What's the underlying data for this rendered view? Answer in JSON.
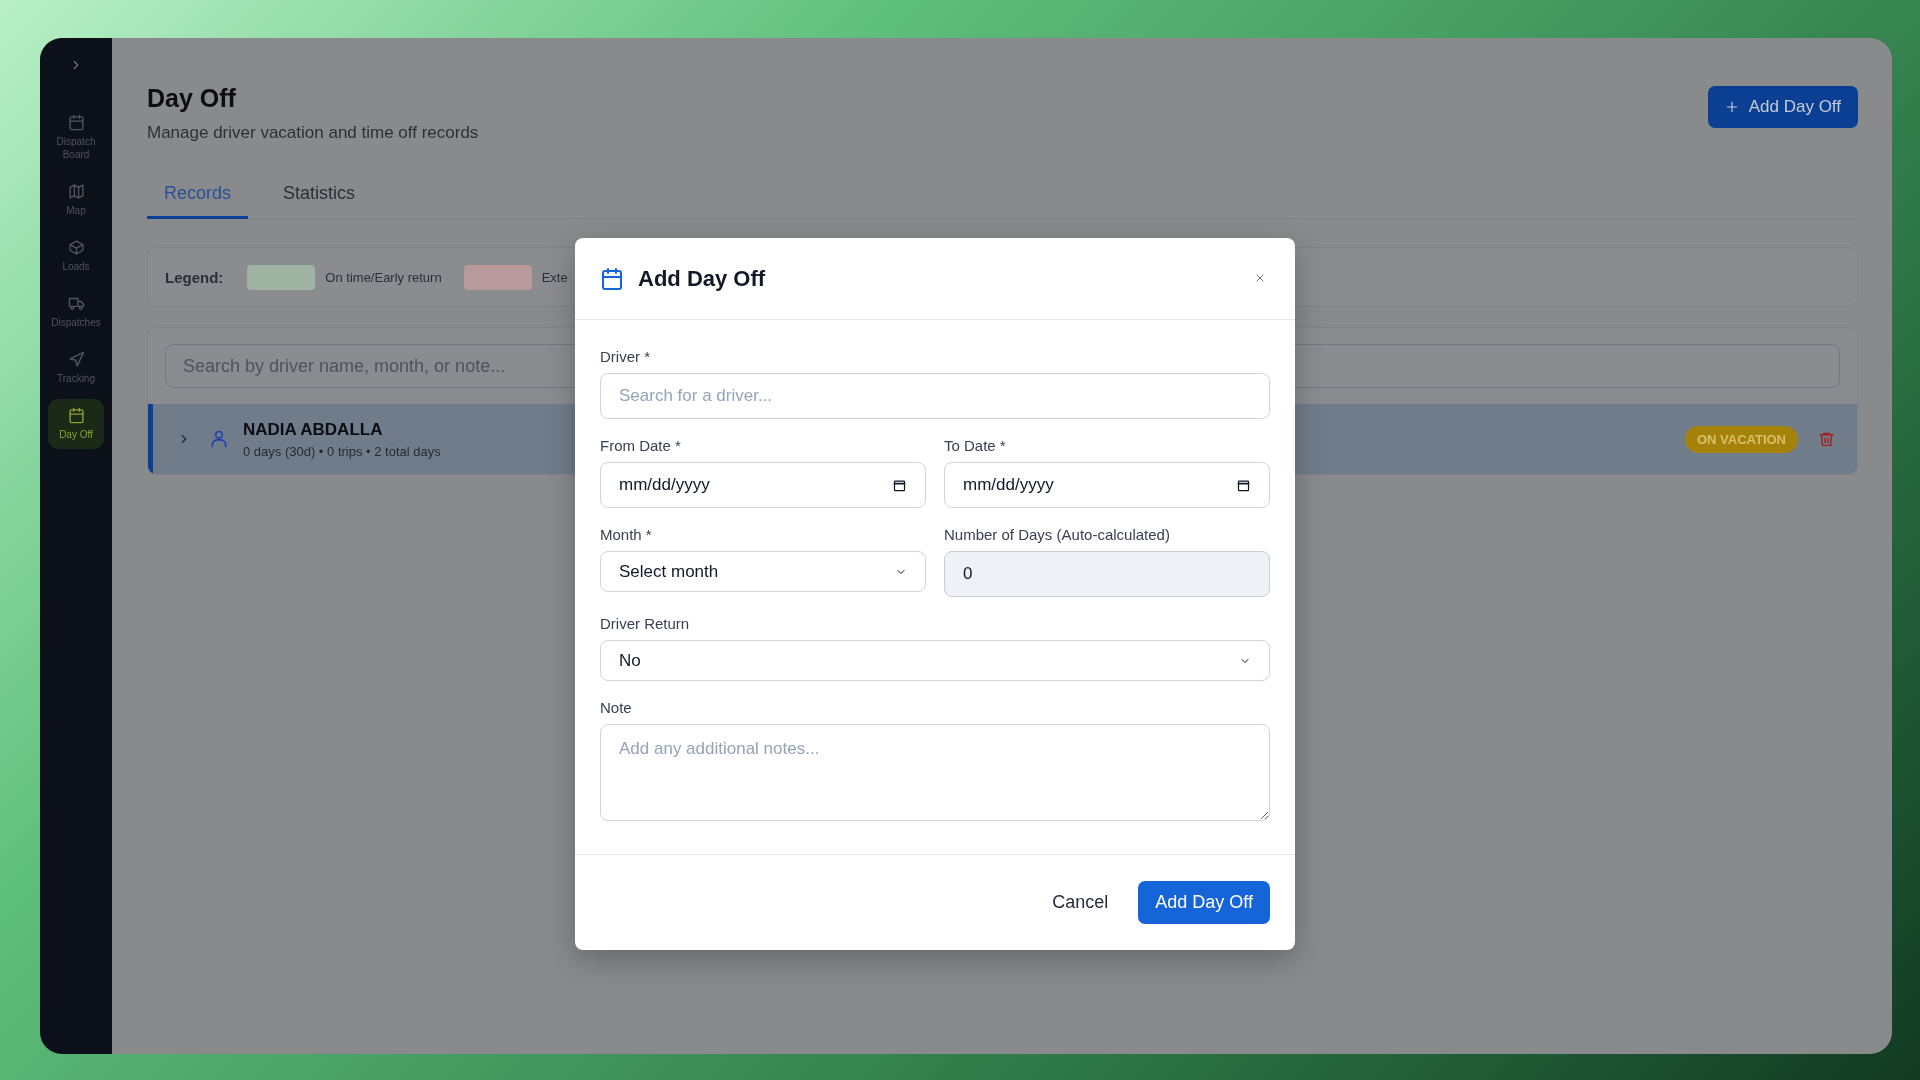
{
  "sidebar": {
    "items": [
      {
        "label": "Dispatch Board",
        "selected": false
      },
      {
        "label": "Map",
        "selected": false
      },
      {
        "label": "Loads",
        "selected": false
      },
      {
        "label": "Dispatches",
        "selected": false
      },
      {
        "label": "Tracking",
        "selected": false
      },
      {
        "label": "Day Off",
        "selected": true
      }
    ]
  },
  "header": {
    "title": "Day Off",
    "subtitle": "Manage driver vacation and time off records",
    "add_button": "Add Day Off"
  },
  "tabs": [
    {
      "label": "Records",
      "selected": true
    },
    {
      "label": "Statistics",
      "selected": false
    }
  ],
  "legend": {
    "label": "Legend:",
    "items": [
      {
        "label": "On time/Early return",
        "color": "#9fb3a3"
      },
      {
        "label": "Exte",
        "color": "#b89a9c"
      }
    ]
  },
  "search": {
    "placeholder": "Search by driver name, month, or note..."
  },
  "records": [
    {
      "name": "NADIA ABDALLA",
      "summary": "0 days (30d) • 0 trips • 2 total days",
      "status": "ON VACATION",
      "expanded": false
    }
  ],
  "modal": {
    "title": "Add Day Off",
    "rows": [
      [
        {
          "label": "Driver *",
          "kind": "text",
          "placeholder": "Search for a driver...",
          "readonly": false
        }
      ],
      [
        {
          "label": "From Date *",
          "kind": "date",
          "value": "mm/dd/yyyy",
          "readonly": false
        },
        {
          "label": "To Date *",
          "kind": "date",
          "value": "mm/dd/yyyy",
          "readonly": false
        }
      ],
      [
        {
          "label": "Month *",
          "kind": "select",
          "value": "Select month",
          "readonly": false
        },
        {
          "label": "Number of Days (Auto-calculated)",
          "kind": "text",
          "value": "0",
          "readonly": true
        }
      ],
      [
        {
          "label": "Driver Return",
          "kind": "select",
          "value": "No",
          "readonly": false
        }
      ],
      [
        {
          "label": "Note",
          "kind": "textarea",
          "placeholder": "Add any additional notes...",
          "readonly": false
        }
      ]
    ],
    "cancel": "Cancel",
    "submit": "Add Day Off"
  }
}
